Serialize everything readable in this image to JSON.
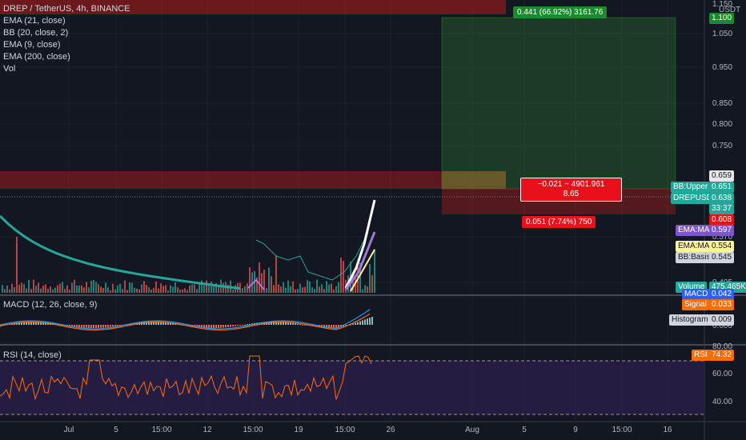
{
  "legend": {
    "symbol": "DREP / TetherUS, 4h, BINANCE",
    "indicators": [
      "EMA (21, close)",
      "BB (20, close, 2)",
      "EMA (9, close)",
      "EMA (200, close)",
      "Vol"
    ]
  },
  "macd_pane": {
    "title": "MACD (12, 26, close, 9)"
  },
  "rsi_pane": {
    "title": "RSI (14, close)"
  },
  "price_axis": {
    "currency": "USDT",
    "labels": [
      "1.150",
      "1.050",
      "0.950",
      "0.850",
      "0.800",
      "0.750",
      "0.570",
      "0.495",
      "0.000",
      "80.00",
      "60.00",
      "40.00"
    ]
  },
  "tags": {
    "target": "1.100",
    "stop_top": "0.659",
    "bb_upper_label": "BB:Upper",
    "bb_upper_value": "0.651",
    "symbol_label": "DREPUSDT",
    "symbol_value": "0.638",
    "countdown": "33:37",
    "stop": "0.608",
    "ema_ma_label": "EMA:MA",
    "ema_ma_value": "0.597",
    "ema_ma2_label": "EMA:MA",
    "ema_ma2_value": "0.554",
    "bb_basis_label": "BB:Basis",
    "bb_basis_value": "0.545",
    "volume_label": "Volume",
    "volume_value": "475.465K",
    "macd_label": "MACD",
    "macd_value": "0.042",
    "signal_label": "Signal",
    "signal_value": "0.033",
    "histogram_label": "Histogram",
    "histogram_value": "0.009",
    "rsi_label": "RSI",
    "rsi_value": "74.32"
  },
  "position": {
    "target_text": "0.441 (66.92%) 3161.76",
    "center_line1": "−0.021 ~ 4901.961",
    "center_line2": "8.65",
    "stop_text": "0.051 (7.74%) 750"
  },
  "time_axis": [
    "Jul",
    "5",
    "15:00",
    "12",
    "15:00",
    "19",
    "15:00",
    "26",
    "Aug",
    "5",
    "9",
    "15:00",
    "16"
  ],
  "colors": {
    "background": "#131722",
    "profit": "#1b5e20",
    "loss": "#b71c1c",
    "ema200": "#26a69a",
    "macd": "#2196f3",
    "signal": "#ff6d00",
    "rsi": "#ff6d00",
    "rsi_band": "#2a1f4a"
  }
}
